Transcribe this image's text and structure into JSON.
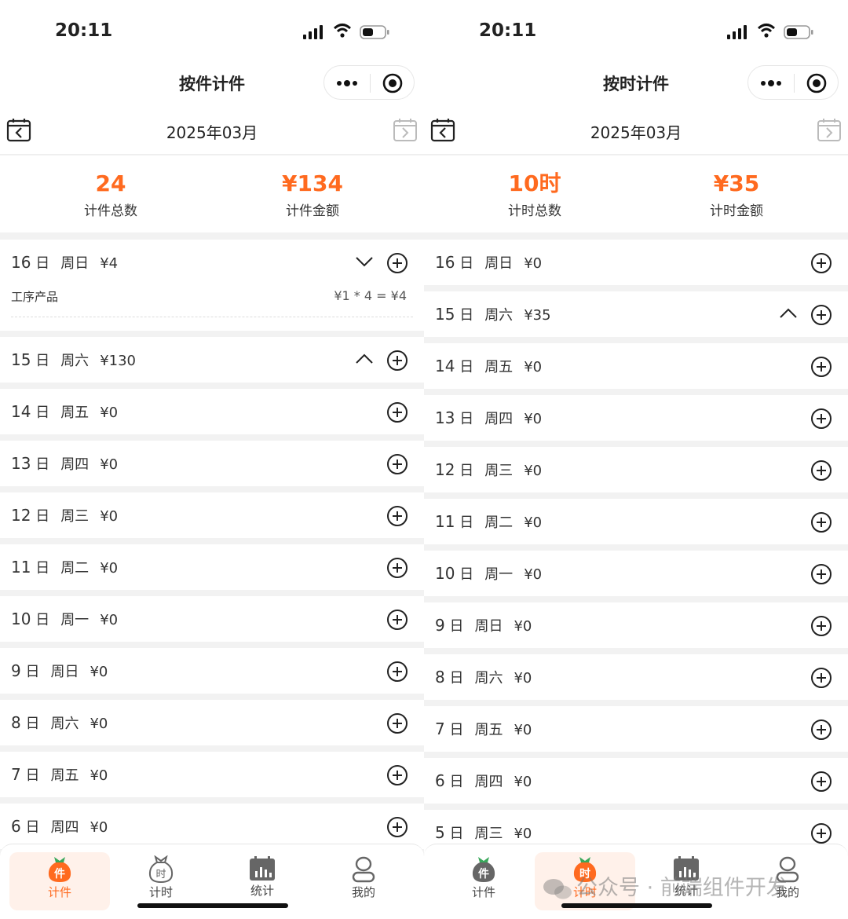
{
  "status": {
    "time": "20:11"
  },
  "screens": [
    {
      "title": "按件计件",
      "month": "2025年03月",
      "summary": {
        "count_value": "24",
        "count_label": "计件总数",
        "amount_value": "¥134",
        "amount_label": "计件金额"
      },
      "detail": {
        "name": "工序产品",
        "calc": "¥1 * 4 =  ¥4"
      },
      "days": [
        {
          "num": "16",
          "unit": "日",
          "weekday": "周日",
          "amount": "¥4",
          "chevron": "down",
          "open": true
        },
        {
          "num": "15",
          "unit": "日",
          "weekday": "周六",
          "amount": "¥130",
          "chevron": "up",
          "open": false
        },
        {
          "num": "14",
          "unit": "日",
          "weekday": "周五",
          "amount": "¥0"
        },
        {
          "num": "13",
          "unit": "日",
          "weekday": "周四",
          "amount": "¥0"
        },
        {
          "num": "12",
          "unit": "日",
          "weekday": "周三",
          "amount": "¥0"
        },
        {
          "num": "11",
          "unit": "日",
          "weekday": "周二",
          "amount": "¥0"
        },
        {
          "num": "10",
          "unit": "日",
          "weekday": "周一",
          "amount": "¥0"
        },
        {
          "num": "9",
          "unit": "日",
          "weekday": "周日",
          "amount": "¥0"
        },
        {
          "num": "8",
          "unit": "日",
          "weekday": "周六",
          "amount": "¥0"
        },
        {
          "num": "7",
          "unit": "日",
          "weekday": "周五",
          "amount": "¥0"
        },
        {
          "num": "6",
          "unit": "日",
          "weekday": "周四",
          "amount": "¥0"
        }
      ],
      "active_tab": 0
    },
    {
      "title": "按时计件",
      "month": "2025年03月",
      "summary": {
        "count_value": "10时",
        "count_label": "计时总数",
        "amount_value": "¥35",
        "amount_label": "计时金额"
      },
      "days": [
        {
          "num": "16",
          "unit": "日",
          "weekday": "周日",
          "amount": "¥0"
        },
        {
          "num": "15",
          "unit": "日",
          "weekday": "周六",
          "amount": "¥35",
          "chevron": "up"
        },
        {
          "num": "14",
          "unit": "日",
          "weekday": "周五",
          "amount": "¥0"
        },
        {
          "num": "13",
          "unit": "日",
          "weekday": "周四",
          "amount": "¥0"
        },
        {
          "num": "12",
          "unit": "日",
          "weekday": "周三",
          "amount": "¥0"
        },
        {
          "num": "11",
          "unit": "日",
          "weekday": "周二",
          "amount": "¥0"
        },
        {
          "num": "10",
          "unit": "日",
          "weekday": "周一",
          "amount": "¥0"
        },
        {
          "num": "9",
          "unit": "日",
          "weekday": "周日",
          "amount": "¥0"
        },
        {
          "num": "8",
          "unit": "日",
          "weekday": "周六",
          "amount": "¥0"
        },
        {
          "num": "7",
          "unit": "日",
          "weekday": "周五",
          "amount": "¥0"
        },
        {
          "num": "6",
          "unit": "日",
          "weekday": "周四",
          "amount": "¥0"
        },
        {
          "num": "5",
          "unit": "日",
          "weekday": "周三",
          "amount": "¥0"
        }
      ],
      "active_tab": 1
    }
  ],
  "tabs": [
    {
      "label": "计件",
      "icon": "piece-bag-icon"
    },
    {
      "label": "计时",
      "icon": "time-bag-icon"
    },
    {
      "label": "统计",
      "icon": "stats-calendar-icon"
    },
    {
      "label": "我的",
      "icon": "user-icon"
    }
  ],
  "watermark": "公众号 · 前端组件开发",
  "colors": {
    "accent": "#ff6a1f",
    "tab_active_bg": "#fff1ea",
    "background": "#f2f2f2"
  }
}
